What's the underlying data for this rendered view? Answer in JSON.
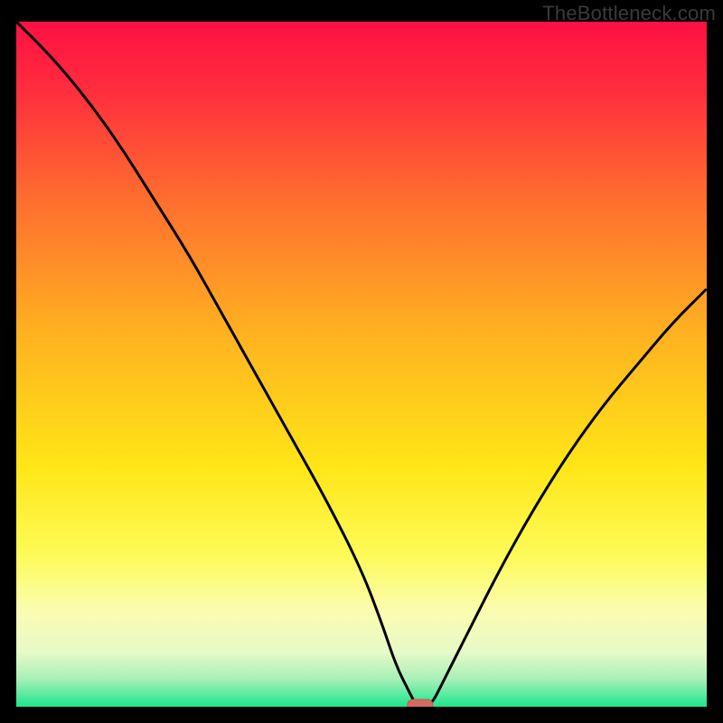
{
  "watermark": "TheBottleneck.com",
  "chart_data": {
    "type": "line",
    "title": "",
    "xlabel": "",
    "ylabel": "",
    "xlim": [
      0,
      100
    ],
    "ylim": [
      0,
      100
    ],
    "series": [
      {
        "name": "bottleneck-curve",
        "x": [
          0,
          5,
          10,
          15,
          20,
          25,
          30,
          35,
          40,
          45,
          50,
          53,
          55,
          57,
          58,
          60,
          62,
          65,
          70,
          75,
          80,
          85,
          90,
          95,
          100
        ],
        "y": [
          100,
          95,
          89,
          82,
          74,
          66,
          57,
          48,
          39,
          30,
          20,
          12,
          6,
          2,
          0,
          0,
          4,
          10,
          20,
          29,
          37,
          44,
          50,
          56,
          61
        ]
      }
    ],
    "marker": {
      "x": 58.5,
      "y": 0
    },
    "gradient_stops": [
      {
        "offset": 0.0,
        "color": "#ff1043"
      },
      {
        "offset": 0.1,
        "color": "#ff2d3e"
      },
      {
        "offset": 0.25,
        "color": "#ff6a30"
      },
      {
        "offset": 0.45,
        "color": "#ffb020"
      },
      {
        "offset": 0.65,
        "color": "#ffe617"
      },
      {
        "offset": 0.78,
        "color": "#fdfb59"
      },
      {
        "offset": 0.86,
        "color": "#fbfcb0"
      },
      {
        "offset": 0.92,
        "color": "#e7fac8"
      },
      {
        "offset": 0.96,
        "color": "#a7f0b7"
      },
      {
        "offset": 1.0,
        "color": "#1de58e"
      }
    ],
    "colors": {
      "background": "#000000",
      "curve": "#000000",
      "marker_fill": "#d46a62",
      "marker_stroke": "#c05850"
    }
  }
}
